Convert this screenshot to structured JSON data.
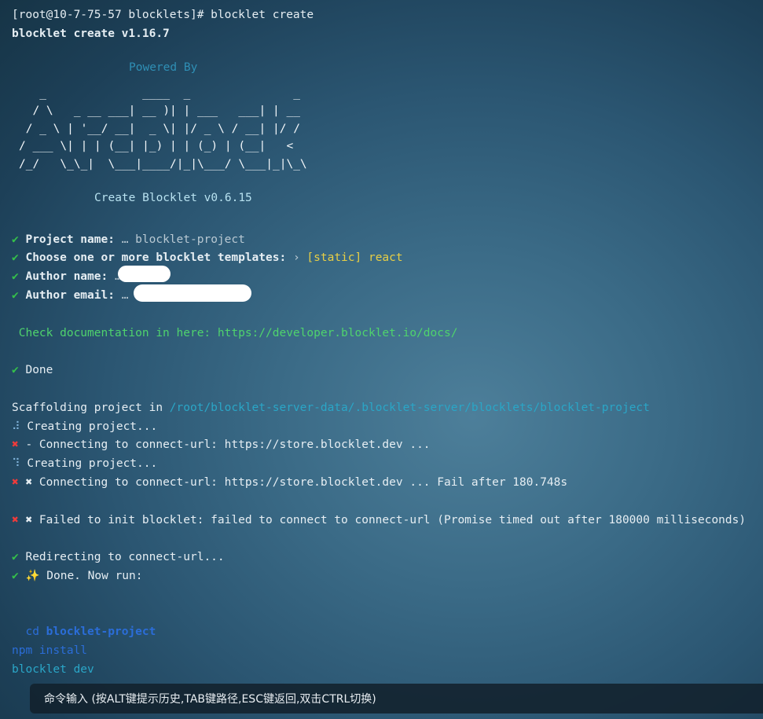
{
  "session": {
    "prompt": "[root@10-7-75-57 blocklets]# blocklet create",
    "version_line": "blocklet create v1.16.7"
  },
  "banner": {
    "powered_by": "Powered By",
    "ascii_art": "   _              ____  _               _\n  / \\   _ __ ___| __ )| | ___   ___| | __\n / _ \\ | '__/ __|  _ \\| |/ _ \\ / __| |/ /\n/ ___ \\| | | (__| |_) | | (_) | (__|   <\n/_/   \\_\\_|  \\___|____/|_|\\___/ \\___|_|\\_\\",
    "create_blocklet": "Create Blocklet v0.6.15"
  },
  "prompts": {
    "check_mark": "✔",
    "project_name_label": "Project name:",
    "project_name_value": "… blocklet-project",
    "templates_label": "Choose one or more blocklet templates:",
    "templates_arrow": "›",
    "templates_value": "[static] react",
    "author_name_label": "Author name:",
    "author_name_value": "…",
    "author_email_label": "Author email:",
    "author_email_value": "…"
  },
  "docs": {
    "text": "Check documentation in here: https://developer.blocklet.io/docs/"
  },
  "progress": {
    "done": "Done",
    "scaffolding_label": "Scaffolding project in",
    "scaffolding_path": "/root/blocklet-server-data/.blocklet-server/blocklets/blocklet-project",
    "spinner1": "⠼",
    "creating1": "Creating project...",
    "cross_mark": "✖",
    "connecting1": "- Connecting to connect-url: https://store.blocklet.dev ...",
    "spinner2": "⠹",
    "creating2": "Creating project...",
    "connecting_fail": "✖ Connecting to connect-url: https://store.blocklet.dev ... Fail after 180.748s",
    "init_failed": "✖ Failed to init blocklet: failed to connect to connect-url (Promise timed out after 180000 milliseconds)",
    "redirecting": "Redirecting to connect-url...",
    "sparkle": "✨",
    "done_now_run": "Done. Now run:"
  },
  "commands": {
    "cd_keyword": "cd",
    "cd_target": "blocklet-project",
    "npm_install": "npm install",
    "blocklet_dev": "blocklet dev"
  },
  "status_bar": {
    "hint": "命令输入 (按ALT键提示历史,TAB键路径,ESC键返回,双击CTRL切换)"
  }
}
